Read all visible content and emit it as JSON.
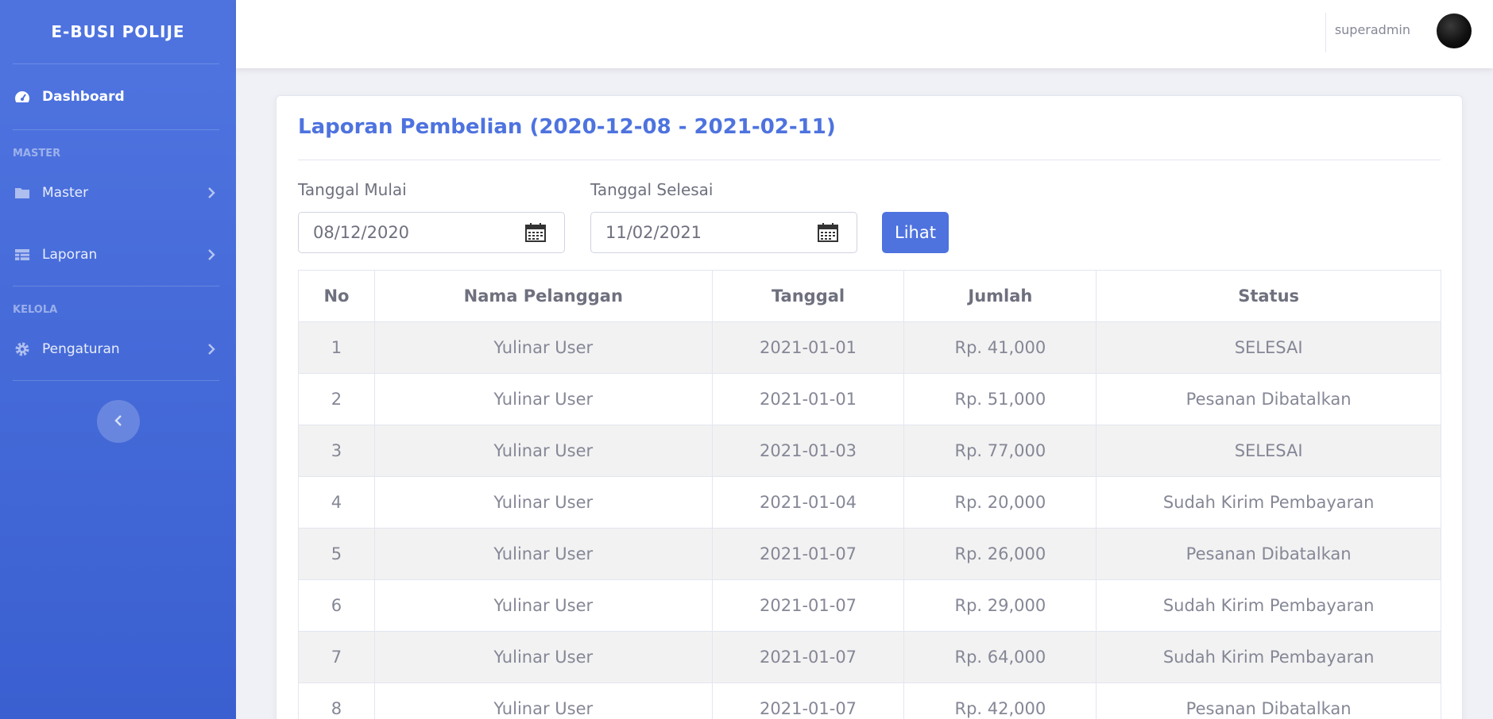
{
  "sidebar": {
    "brand": "E-BUSI POLIJE",
    "dashboard_label": "Dashboard",
    "heading_master": "MASTER",
    "master_label": "Master",
    "laporan_label": "Laporan",
    "heading_kelola": "KELOLA",
    "pengaturan_label": "Pengaturan"
  },
  "topbar": {
    "username": "superadmin"
  },
  "report": {
    "title": "Laporan Pembelian (2020-12-08 - 2021-02-11)",
    "start_label": "Tanggal Mulai",
    "start_value": "08/12/2020",
    "end_label": "Tanggal Selesai",
    "end_value": "11/02/2021",
    "view_button": "Lihat"
  },
  "table": {
    "headers": [
      "No",
      "Nama Pelanggan",
      "Tanggal",
      "Jumlah",
      "Status"
    ],
    "rows": [
      [
        "1",
        "Yulinar User",
        "2021-01-01",
        "Rp. 41,000",
        "SELESAI"
      ],
      [
        "2",
        "Yulinar User",
        "2021-01-01",
        "Rp. 51,000",
        "Pesanan Dibatalkan"
      ],
      [
        "3",
        "Yulinar User",
        "2021-01-03",
        "Rp. 77,000",
        "SELESAI"
      ],
      [
        "4",
        "Yulinar User",
        "2021-01-04",
        "Rp. 20,000",
        "Sudah Kirim Pembayaran"
      ],
      [
        "5",
        "Yulinar User",
        "2021-01-07",
        "Rp. 26,000",
        "Pesanan Dibatalkan"
      ],
      [
        "6",
        "Yulinar User",
        "2021-01-07",
        "Rp. 29,000",
        "Sudah Kirim Pembayaran"
      ],
      [
        "7",
        "Yulinar User",
        "2021-01-07",
        "Rp. 64,000",
        "Sudah Kirim Pembayaran"
      ],
      [
        "8",
        "Yulinar User",
        "2021-01-07",
        "Rp. 42,000",
        "Pesanan Dibatalkan"
      ]
    ]
  },
  "colors": {
    "primary": "#4e73df",
    "text": "#858796"
  }
}
